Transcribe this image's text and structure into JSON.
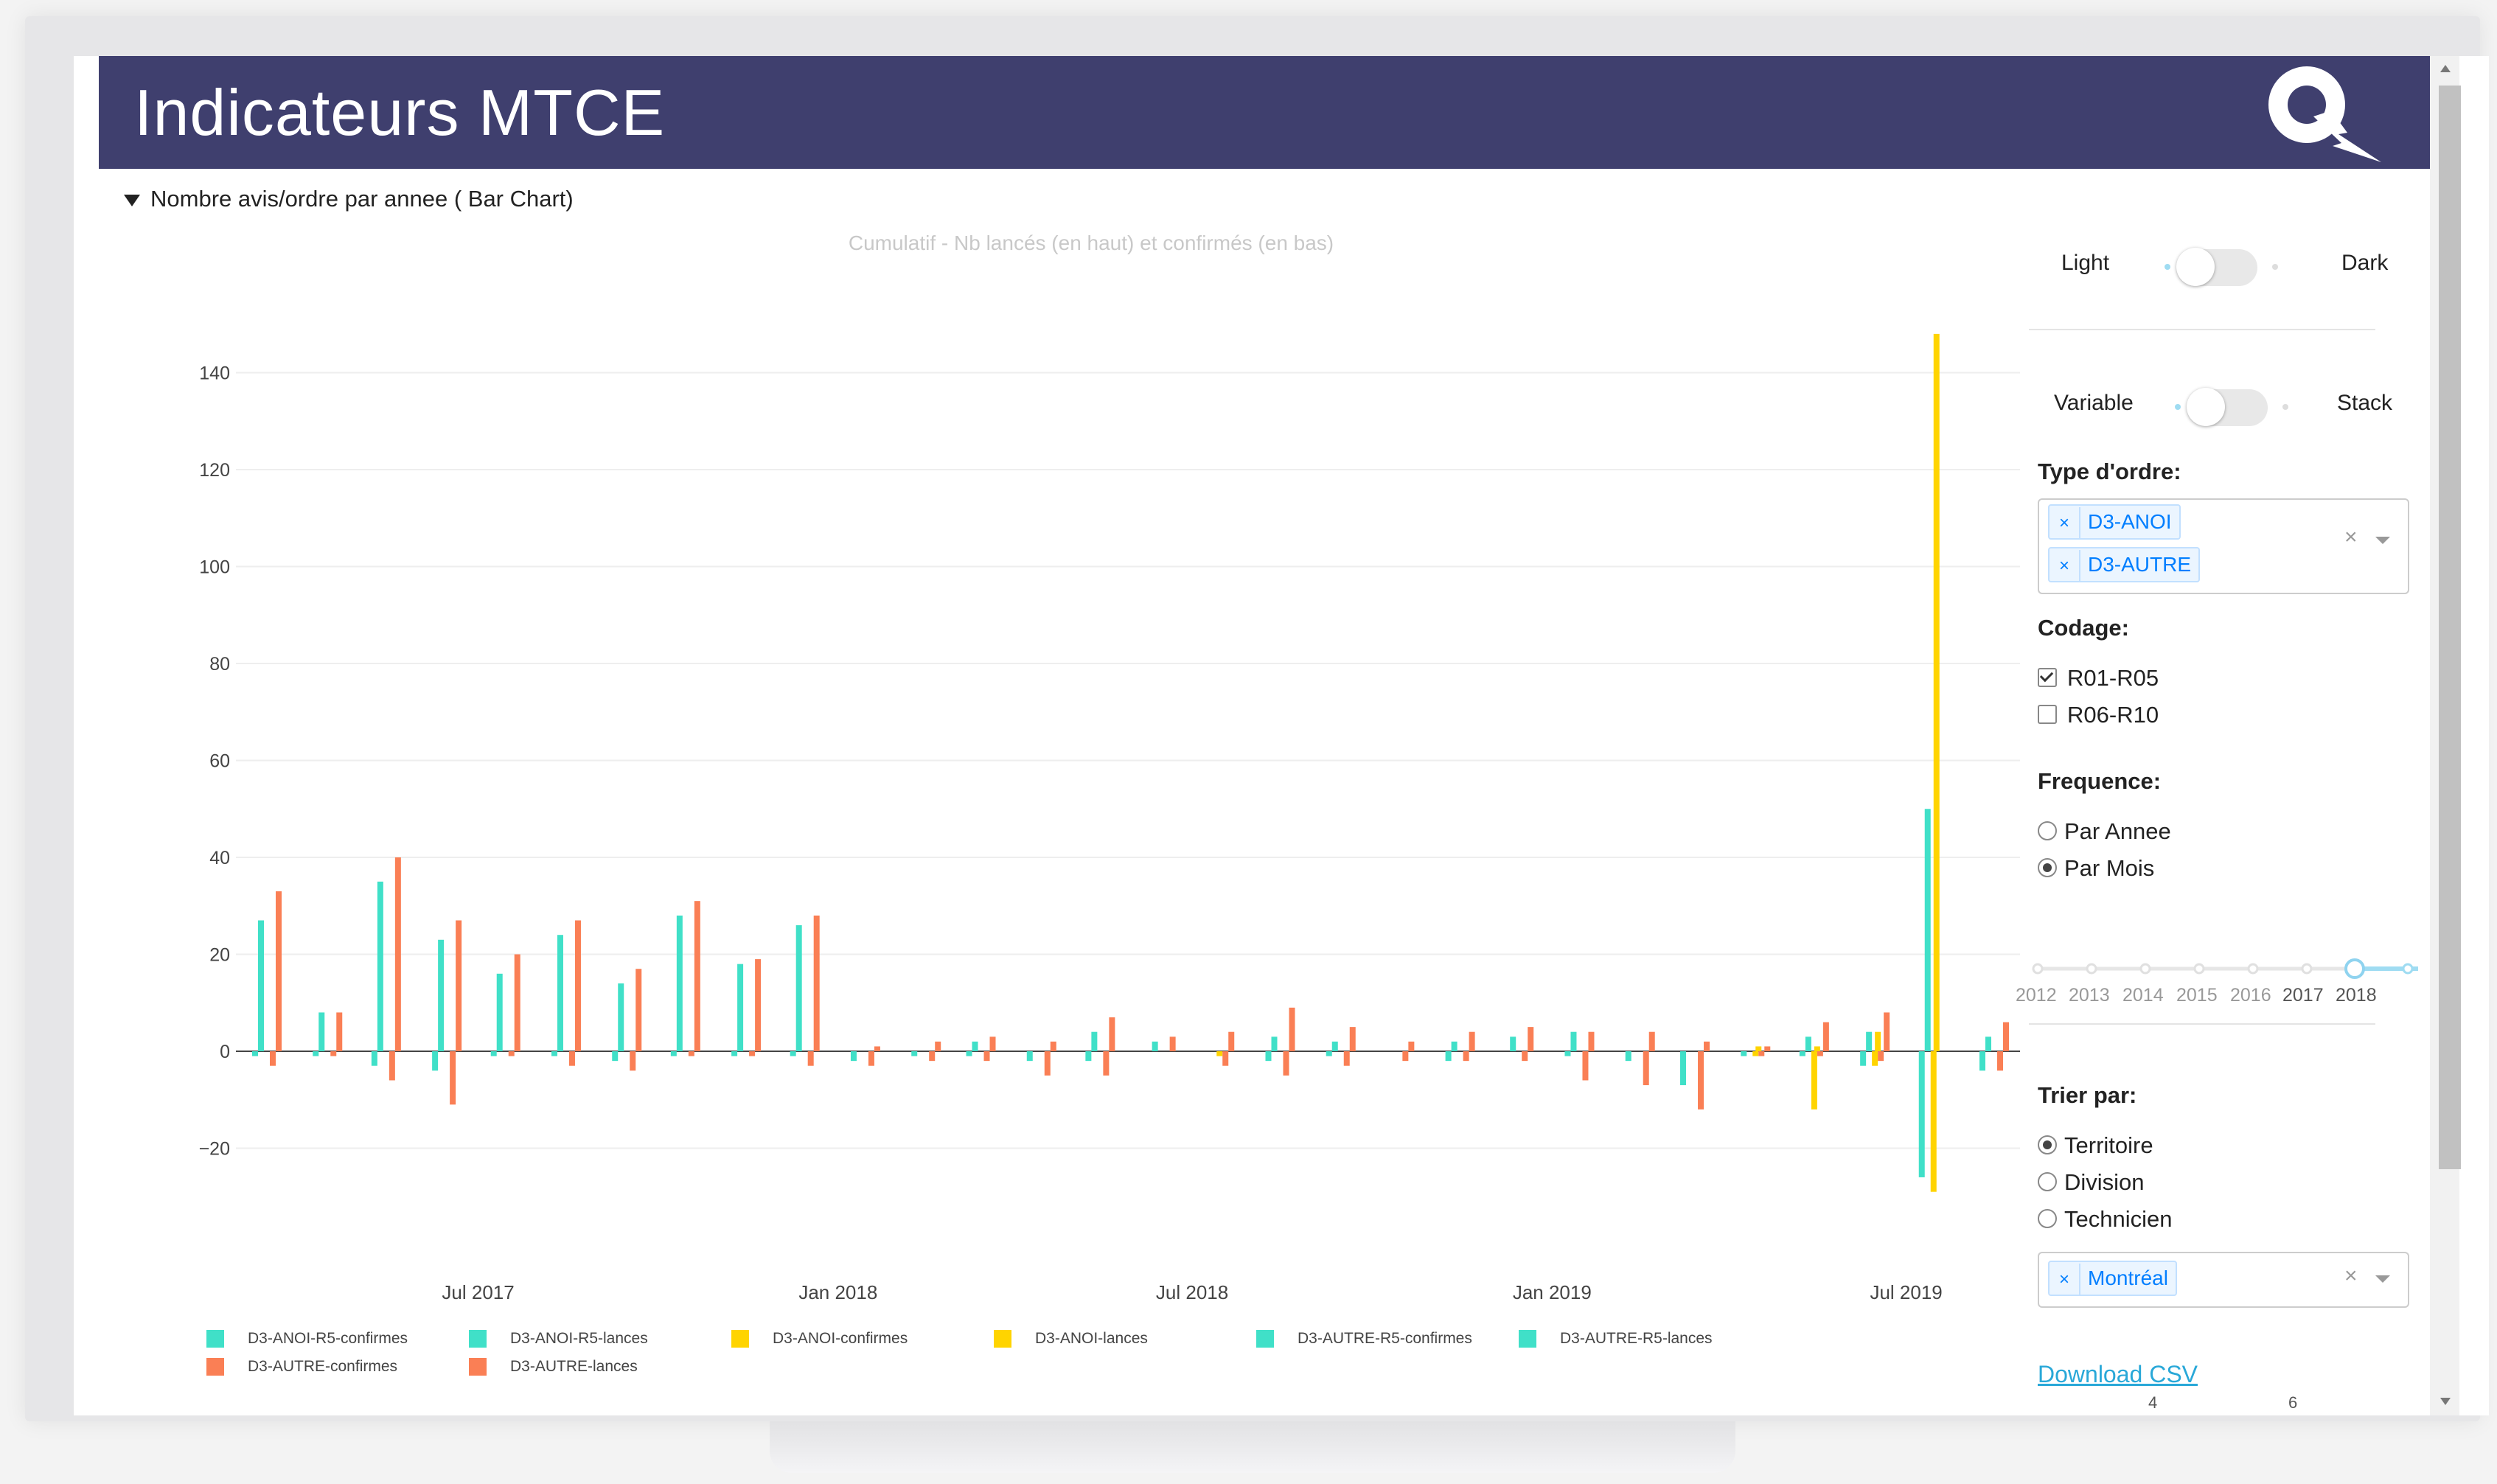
{
  "header": {
    "title": "Indicateurs MTCE"
  },
  "section": {
    "label": "Nombre avis/ordre par annee ( Bar Chart)"
  },
  "chart_data": {
    "type": "bar",
    "title": "Cumulatif - Nb lancés (en haut) et confirmés (en bas)",
    "ylim": [
      -30,
      150
    ],
    "yticks": [
      140,
      120,
      100,
      80,
      60,
      40,
      20,
      0,
      -20
    ],
    "ytick_labels": [
      "140",
      "120",
      "100",
      "80",
      "60",
      "40",
      "20",
      "0",
      "−20"
    ],
    "xticks": [
      "Jul 2017",
      "Jan 2018",
      "Jul 2018",
      "Jan 2019",
      "Jul 2019"
    ],
    "grid": true,
    "legend_position": "bottom",
    "series": [
      {
        "name": "D3-ANOI-R5-confirmes",
        "color": "#40e0c8"
      },
      {
        "name": "D3-ANOI-R5-lances",
        "color": "#40e0c8"
      },
      {
        "name": "D3-ANOI-confirmes",
        "color": "#ffd400"
      },
      {
        "name": "D3-ANOI-lances",
        "color": "#ffd400"
      },
      {
        "name": "D3-AUTRE-R5-confirmes",
        "color": "#40e0c8"
      },
      {
        "name": "D3-AUTRE-R5-lances",
        "color": "#40e0c8"
      },
      {
        "name": "D3-AUTRE-confirmes",
        "color": "#fa7f55"
      },
      {
        "name": "D3-AUTRE-lances",
        "color": "#fa7f55"
      }
    ],
    "months": [
      "2017-03",
      "2017-04",
      "2017-05",
      "2017-06",
      "2017-07",
      "2017-08",
      "2017-09",
      "2017-10",
      "2017-11",
      "2017-12",
      "2018-01",
      "2018-02",
      "2018-03",
      "2018-04",
      "2018-05",
      "2018-06",
      "2018-07",
      "2018-08",
      "2018-09",
      "2018-10",
      "2018-11",
      "2018-12",
      "2019-01",
      "2019-02",
      "2019-03",
      "2019-04",
      "2019-05",
      "2019-06",
      "2019-07",
      "2019-08"
    ],
    "teal_up": [
      27,
      8,
      35,
      23,
      16,
      24,
      14,
      28,
      18,
      26,
      0,
      0,
      2,
      0,
      4,
      2,
      0,
      3,
      2,
      0,
      2,
      3,
      4,
      0,
      0,
      0,
      3,
      4,
      50,
      3
    ],
    "teal_down": [
      -1,
      -1,
      -3,
      -4,
      -1,
      -1,
      -2,
      -1,
      -1,
      -1,
      -2,
      -1,
      -1,
      -2,
      -2,
      0,
      0,
      -2,
      -1,
      0,
      -2,
      0,
      -1,
      -2,
      -7,
      -1,
      -1,
      -3,
      -26,
      -4
    ],
    "orange_up": [
      33,
      8,
      40,
      27,
      20,
      27,
      17,
      31,
      19,
      28,
      1,
      2,
      3,
      2,
      7,
      3,
      4,
      9,
      5,
      2,
      4,
      5,
      4,
      4,
      2,
      1,
      6,
      8,
      0,
      6
    ],
    "orange_down": [
      -3,
      -1,
      -6,
      -11,
      -1,
      -3,
      -4,
      -1,
      -1,
      -3,
      -3,
      -2,
      -2,
      -5,
      -5,
      0,
      -3,
      -5,
      -3,
      -2,
      -2,
      -2,
      -6,
      -7,
      -12,
      -1,
      -1,
      -2,
      0,
      -4
    ],
    "yellow_up": [
      0,
      0,
      0,
      0,
      0,
      0,
      0,
      0,
      0,
      0,
      0,
      0,
      0,
      0,
      0,
      0,
      0,
      0,
      0,
      0,
      0,
      0,
      0,
      0,
      0,
      1,
      1,
      4,
      148,
      0
    ],
    "yellow_down": [
      0,
      0,
      0,
      0,
      0,
      0,
      0,
      0,
      0,
      0,
      0,
      0,
      0,
      0,
      0,
      0,
      -1,
      0,
      0,
      0,
      0,
      0,
      0,
      0,
      0,
      -1,
      -12,
      -3,
      -29,
      0
    ]
  },
  "legend": [
    {
      "label": "D3-ANOI-R5-confirmes",
      "color": "#40e0c8"
    },
    {
      "label": "D3-ANOI-R5-lances",
      "color": "#40e0c8"
    },
    {
      "label": "D3-ANOI-confirmes",
      "color": "#ffd400"
    },
    {
      "label": "D3-ANOI-lances",
      "color": "#ffd400"
    },
    {
      "label": "D3-AUTRE-R5-confirmes",
      "color": "#40e0c8"
    },
    {
      "label": "D3-AUTRE-R5-lances",
      "color": "#40e0c8"
    },
    {
      "label": "D3-AUTRE-confirmes",
      "color": "#fa7f55"
    },
    {
      "label": "D3-AUTRE-lances",
      "color": "#fa7f55"
    }
  ],
  "theme_toggle": {
    "left": "Light",
    "right": "Dark"
  },
  "mode_toggle": {
    "left": "Variable",
    "right": "Stack"
  },
  "type_ordre": {
    "label": "Type d'ordre:",
    "tags": [
      "D3-ANOI",
      "D3-AUTRE"
    ],
    "clear": "×"
  },
  "codage": {
    "label": "Codage:",
    "options": [
      {
        "label": "R01-R05",
        "checked": true
      },
      {
        "label": "R06-R10",
        "checked": false
      }
    ]
  },
  "frequence": {
    "label": "Frequence:",
    "options": [
      {
        "label": "Par Annee",
        "checked": false
      },
      {
        "label": "Par Mois",
        "checked": true
      }
    ]
  },
  "year_slider": {
    "years": [
      "2012",
      "2013",
      "2014",
      "2015",
      "2016",
      "2017",
      "2018"
    ],
    "selected_range": [
      "2017",
      "2019"
    ],
    "accent": "#7fd4f0"
  },
  "trier": {
    "label": "Trier par:",
    "options": [
      {
        "label": "Territoire",
        "checked": true
      },
      {
        "label": "Division",
        "checked": false
      },
      {
        "label": "Technicien",
        "checked": false
      }
    ],
    "tags": [
      "Montréal"
    ],
    "clear": "×"
  },
  "download": {
    "label": "Download CSV"
  },
  "bottom_numbers": [
    "4",
    "6"
  ]
}
